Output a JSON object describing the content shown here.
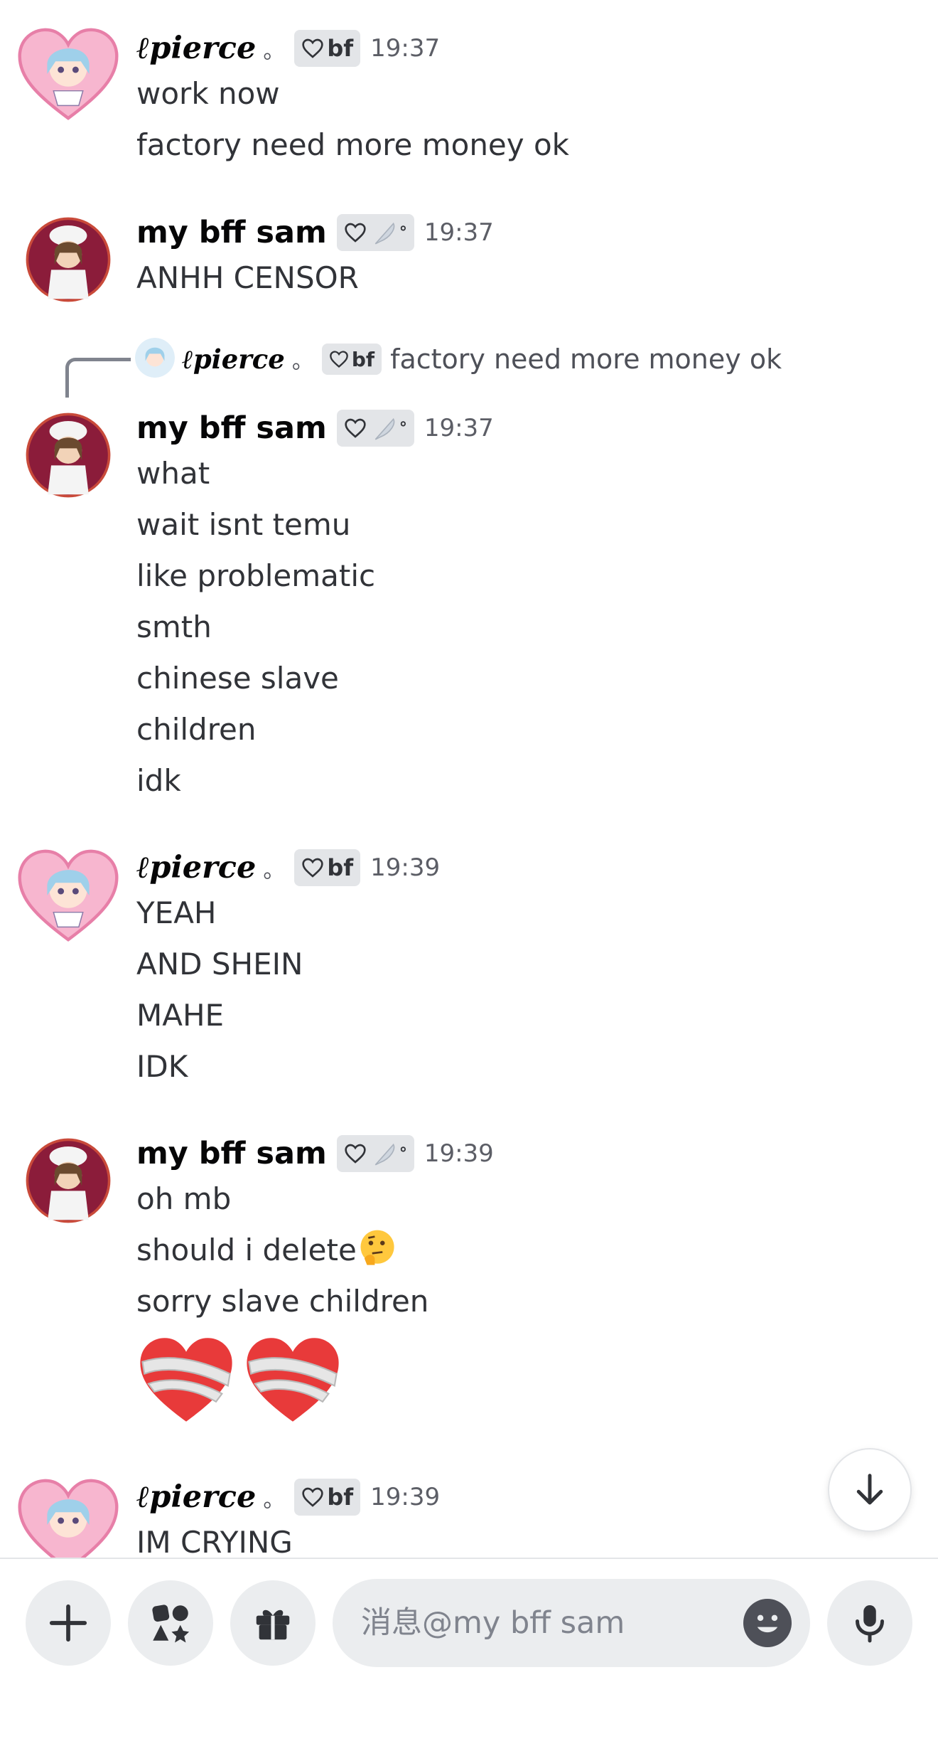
{
  "messages": [
    {
      "author": "pierce",
      "author_prefix": "ℓ",
      "author_suffix": "。",
      "tag": "bf",
      "time": "19:37",
      "lines": [
        "work now",
        "factory need more money ok"
      ]
    },
    {
      "author": "my bff sam",
      "time": "19:37",
      "lines": [
        "ANHH CENSOR"
      ]
    },
    {
      "reply_to": {
        "author_prefix": "ℓ",
        "author": "pierce",
        "author_suffix": "。",
        "tag": "bf",
        "text": "factory need more money ok"
      },
      "author": "my bff sam",
      "time": "19:37",
      "lines": [
        "what",
        "wait isnt temu",
        "like problematic",
        "smth",
        "chinese slave",
        "children",
        "idk"
      ]
    },
    {
      "author_prefix": "ℓ",
      "author": "pierce",
      "author_suffix": "。",
      "tag": "bf",
      "time": "19:39",
      "lines": [
        "YEAH",
        "AND SHEIN",
        "MAHE",
        "IDK"
      ]
    },
    {
      "author": "my bff sam",
      "time": "19:39",
      "lines": [
        "oh mb",
        "should i delete",
        "sorry slave children"
      ],
      "emojis": [
        "thinking-face",
        "mending-heart",
        "mending-heart"
      ]
    },
    {
      "author_prefix": "ℓ",
      "author": "pierce",
      "author_suffix": "。",
      "tag": "bf",
      "time": "19:39",
      "lines": [
        "IM CRYING"
      ]
    }
  ],
  "composer": {
    "placeholder": "消息@my bff sam",
    "buttons": [
      "plus-icon",
      "apps-icon",
      "gift-icon",
      "emoji-icon",
      "microphone-icon"
    ]
  },
  "colors": {
    "text": "#313338",
    "muted": "#5c5e66",
    "tag_bg": "#e3e5e8",
    "input_bg": "#ebedef"
  }
}
